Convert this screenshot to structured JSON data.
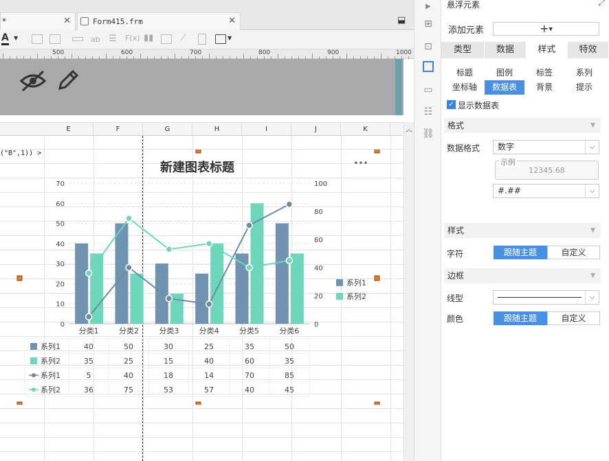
{
  "tabs": [
    {
      "label": "*"
    },
    {
      "label": "Form415.frm"
    }
  ],
  "ruler": [
    "500",
    "600",
    "700",
    "800",
    "900",
    "1000"
  ],
  "columns": [
    "E",
    "F",
    "G",
    "H",
    "I",
    "J",
    "K"
  ],
  "formula_fragment": "(\"B\",1)) >",
  "chart_data": {
    "type": "bar",
    "title": "新建图表标题",
    "categories": [
      "分类1",
      "分类2",
      "分类3",
      "分类4",
      "分类5",
      "分类6"
    ],
    "series": [
      {
        "name": "系列1",
        "kind": "bar",
        "values": [
          40,
          50,
          30,
          25,
          35,
          50
        ],
        "color": "#6f93b1"
      },
      {
        "name": "系列2",
        "kind": "bar",
        "values": [
          35,
          25,
          15,
          40,
          60,
          35
        ],
        "color": "#6ed6bb"
      },
      {
        "name": "系列1",
        "kind": "line",
        "axis": "right",
        "values": [
          5,
          40,
          18,
          14,
          70,
          85
        ],
        "color": "#6f8aa3"
      },
      {
        "name": "系列2",
        "kind": "line",
        "axis": "right",
        "values": [
          36,
          75,
          53,
          57,
          40,
          45
        ],
        "color": "#6ed6bb"
      }
    ],
    "ylim": [
      0,
      70
    ],
    "y_ticks": [
      "0",
      "10",
      "20",
      "30",
      "40",
      "50",
      "60",
      "70"
    ],
    "y2lim": [
      0,
      100
    ],
    "y2_ticks": [
      "0",
      "20",
      "40",
      "60",
      "80",
      "100"
    ],
    "legend": [
      "系列1",
      "系列2"
    ],
    "legend_position": "right",
    "data_table": true,
    "more": "•••"
  },
  "panel": {
    "header": "悬浮元素",
    "add_label": "添加元素",
    "add_button": "+",
    "tabs": [
      "类型",
      "数据",
      "样式",
      "特效"
    ],
    "active_tab": 2,
    "subtabs": [
      "标题",
      "图例",
      "标签",
      "系列",
      "坐标轴",
      "数据表",
      "背景",
      "提示"
    ],
    "active_subtab": 5,
    "show_table_label": "显示数据表",
    "show_table_checked": true,
    "format_section": "格式",
    "data_format_label": "数据格式",
    "data_format_value": "数字",
    "example_label": "示例",
    "example_value": "12345.68",
    "pattern_value": "#.##",
    "style_section": "样式",
    "char_label": "字符",
    "follow_theme": "跟随主题",
    "custom": "自定义",
    "border_section": "边框",
    "line_label": "线型",
    "color_label": "颜色",
    "colors": {
      "accent": "#4a90e2",
      "bar1": "#6f93b1",
      "bar2": "#6ed6bb"
    }
  }
}
